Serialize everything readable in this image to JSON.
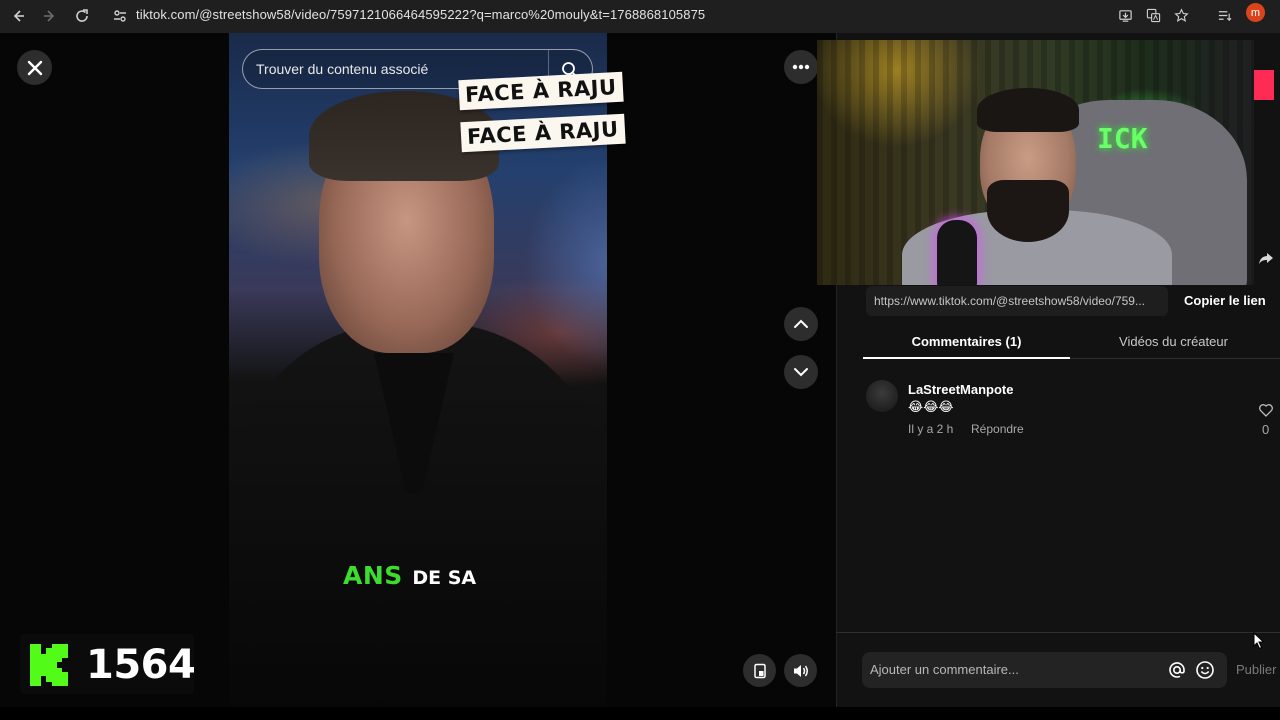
{
  "browser": {
    "url": "tiktok.com/@streetshow58/video/7597121066464595222?q=marco%20mouly&t=1768868105875",
    "profile_initial": "m",
    "icons": [
      "back-icon",
      "forward-icon",
      "reload-icon",
      "site-info-icon",
      "install-icon",
      "translate-icon",
      "bookmark-star-icon",
      "reading-list-icon"
    ]
  },
  "search": {
    "placeholder": "Trouver du contenu associé"
  },
  "video": {
    "sticker_top": "FACE À RAJU",
    "sticker_bottom": "FACE À RAJU",
    "caption_highlight": "ANS",
    "caption_rest": "DE SA"
  },
  "kick": {
    "count": "1564"
  },
  "panel": {
    "link": "https://www.tiktok.com/@streetshow58/video/759...",
    "copy_link_label": "Copier le lien",
    "tabs": [
      {
        "label": "Commentaires (1)",
        "active": true
      },
      {
        "label": "Vidéos du créateur",
        "active": false
      }
    ],
    "comments": [
      {
        "user": "LaStreetManpote",
        "text": "😂😂😂",
        "time": "Il y a 2 h",
        "reply_label": "Répondre",
        "likes": "0"
      }
    ],
    "comment_placeholder": "Ajouter un commentaire...",
    "publish_label": "Publier"
  },
  "webcam": {
    "sign_text": "ICK"
  },
  "colors": {
    "kick_green": "#53fc18",
    "caption_green": "#3ddc2f",
    "tiktok_red": "#fe2c55",
    "panel_bg": "#121212"
  }
}
